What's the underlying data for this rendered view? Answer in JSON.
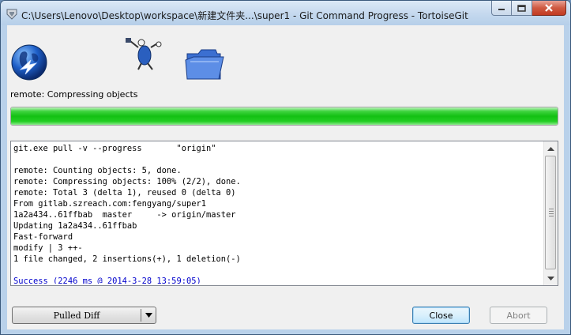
{
  "window": {
    "title": "C:\\Users\\Lenovo\\Desktop\\workspace\\新建文件夹...\\super1 - Git Command Progress - TortoiseGit",
    "app_icon": "tortoisegit-icon"
  },
  "titlebar_buttons": {
    "minimize": "minimize-icon",
    "maximize": "maximize-icon",
    "close": "close-icon"
  },
  "header_icons": [
    "globe-network-icon",
    "tortoise-figure-icon",
    "folder-icon"
  ],
  "status": {
    "text": "remote: Compressing objects"
  },
  "progress": {
    "percent": 100,
    "color": "#13c013"
  },
  "log": {
    "lines": [
      {
        "text": "git.exe pull -v --progress       \"origin\"",
        "type": "normal"
      },
      {
        "text": "",
        "type": "normal"
      },
      {
        "text": "remote: Counting objects: 5, done.",
        "type": "normal"
      },
      {
        "text": "remote: Compressing objects: 100% (2/2), done.",
        "type": "normal"
      },
      {
        "text": "remote: Total 3 (delta 1), reused 0 (delta 0)",
        "type": "normal"
      },
      {
        "text": "From gitlab.szreach.com:fengyang/super1",
        "type": "normal"
      },
      {
        "text": "1a2a434..61ffbab  master     -> origin/master",
        "type": "normal"
      },
      {
        "text": "Updating 1a2a434..61ffbab",
        "type": "normal"
      },
      {
        "text": "Fast-forward",
        "type": "normal"
      },
      {
        "text": "modify | 3 ++-",
        "type": "normal"
      },
      {
        "text": "1 file changed, 2 insertions(+), 1 deletion(-)",
        "type": "normal"
      },
      {
        "text": "",
        "type": "normal"
      },
      {
        "text": "Success (2246 ms @ 2014-3-28 13:59:05)",
        "type": "success"
      }
    ],
    "success_color": "#0000cc"
  },
  "buttons": {
    "pulled_diff": "Pulled Diff",
    "close": "Close",
    "abort": "Abort"
  }
}
